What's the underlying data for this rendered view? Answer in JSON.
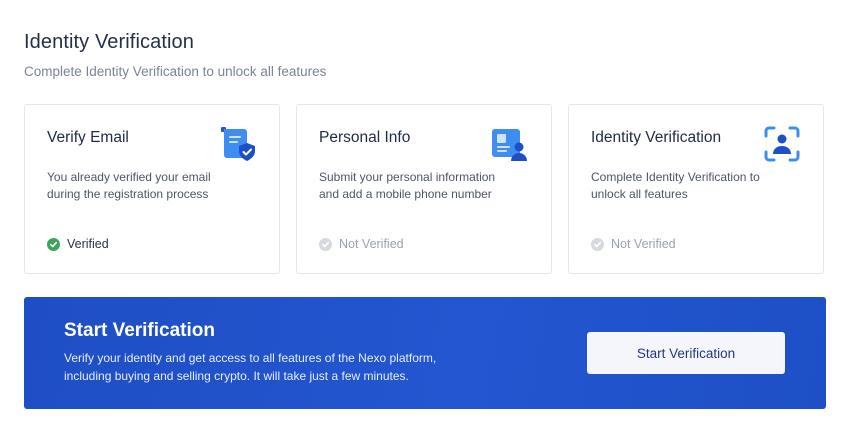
{
  "header": {
    "title": "Identity Verification",
    "subtitle": "Complete Identity Verification to unlock all features"
  },
  "cards": [
    {
      "title": "Verify Email",
      "description": "You already verified your email during the registration process",
      "status": "Verified",
      "icon": "email-verified-icon"
    },
    {
      "title": "Personal Info",
      "description": "Submit your personal information and add a mobile phone number",
      "status": "Not Verified",
      "icon": "id-card-icon"
    },
    {
      "title": "Identity Verification",
      "description": "Complete Identity Verification to unlock all features",
      "status": "Not Verified",
      "icon": "face-scan-icon"
    }
  ],
  "banner": {
    "title": "Start Verification",
    "description": "Verify your identity and get access to all features of the Nexo platform, including buying and selling crypto. It will take just a few minutes.",
    "button_label": "Start Verification"
  },
  "colors": {
    "accent": "#1e4fc6",
    "verified": "#3fa45b",
    "pending": "#d6d9de"
  }
}
